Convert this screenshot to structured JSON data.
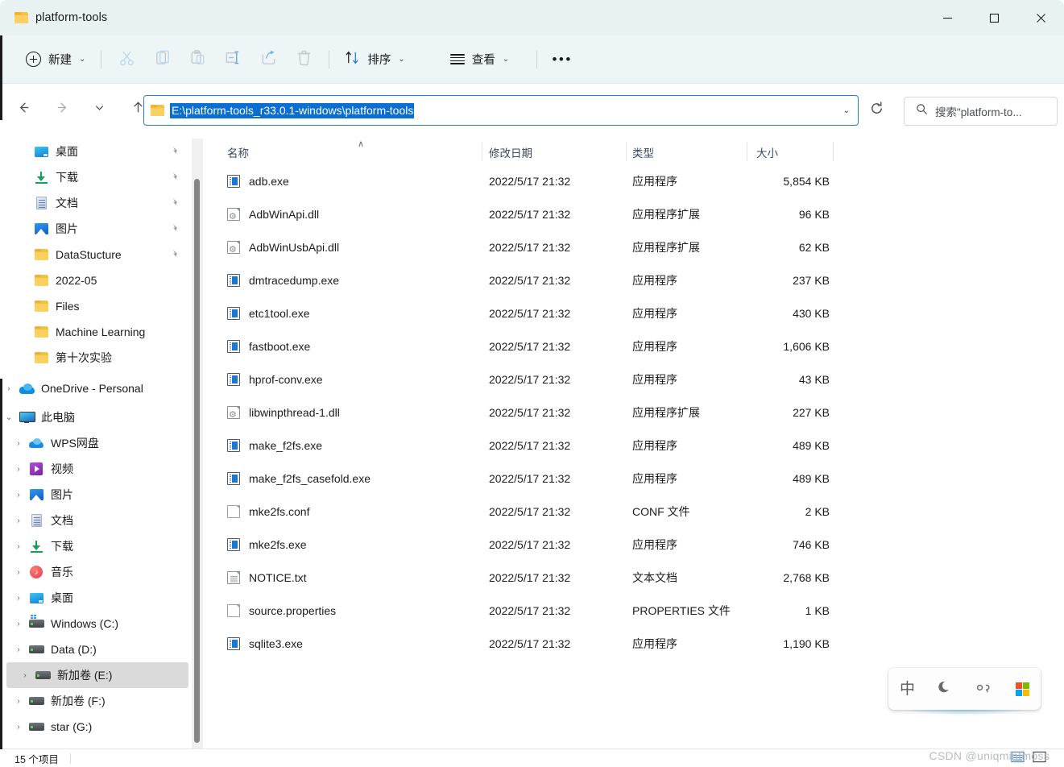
{
  "window": {
    "title": "platform-tools",
    "folder_icon": "folder-icon",
    "minimize": "—",
    "maximize": "□",
    "close": "✕"
  },
  "toolbar": {
    "new_label": "新建",
    "new_icon": "plus-circle-icon",
    "cut_icon": "cut-icon",
    "copy_icon": "copy-icon",
    "paste_icon": "paste-icon",
    "rename_icon": "rename-icon",
    "share_icon": "share-icon",
    "delete_icon": "trash-icon",
    "sort_label": "排序",
    "sort_icon": "sort-icon",
    "view_label": "查看",
    "view_icon": "view-list-icon",
    "more_label": "•••",
    "chevron": "⌄"
  },
  "nav": {
    "back_icon": "arrow-left-icon",
    "forward_icon": "arrow-right-icon",
    "recent_icon": "chevron-down-icon",
    "up_icon": "arrow-up-icon",
    "address_value": "E:\\platform-tools_r33.0.1-windows\\platform-tools",
    "address_chevron": "⌄",
    "refresh_icon": "refresh-icon",
    "search_icon": "search-icon",
    "search_placeholder": "搜索\"platform-to..."
  },
  "sidebar": {
    "quick_access": [
      {
        "label": "桌面",
        "icon": "desktop-icon",
        "pinned": true,
        "expandable": false
      },
      {
        "label": "下载",
        "icon": "download-icon",
        "pinned": true,
        "expandable": false
      },
      {
        "label": "文档",
        "icon": "documents-icon",
        "pinned": true,
        "expandable": false
      },
      {
        "label": "图片",
        "icon": "pictures-icon",
        "pinned": true,
        "expandable": false
      },
      {
        "label": "DataStucture",
        "icon": "folder-icon",
        "pinned": true,
        "expandable": false
      },
      {
        "label": "2022-05",
        "icon": "folder-icon",
        "pinned": false,
        "expandable": false
      },
      {
        "label": "Files",
        "icon": "folder-icon",
        "pinned": false,
        "expandable": false
      },
      {
        "label": "Machine Learning",
        "icon": "folder-icon",
        "pinned": false,
        "expandable": false
      },
      {
        "label": "第十次实验",
        "icon": "folder-icon",
        "pinned": false,
        "expandable": false
      }
    ],
    "onedrive": {
      "label": "OneDrive - Personal",
      "icon": "onedrive-icon",
      "expander": "›"
    },
    "this_pc": {
      "label": "此电脑",
      "icon": "this-pc-icon",
      "expander": "⌄"
    },
    "pc_children": [
      {
        "label": "WPS网盘",
        "icon": "wps-cloud-icon",
        "expander": "›",
        "selected": false
      },
      {
        "label": "视频",
        "icon": "videos-icon",
        "expander": "›",
        "selected": false
      },
      {
        "label": "图片",
        "icon": "pictures-icon",
        "expander": "›",
        "selected": false
      },
      {
        "label": "文档",
        "icon": "documents-icon",
        "expander": "›",
        "selected": false
      },
      {
        "label": "下载",
        "icon": "download-icon",
        "expander": "›",
        "selected": false
      },
      {
        "label": "音乐",
        "icon": "music-icon",
        "expander": "›",
        "selected": false
      },
      {
        "label": "桌面",
        "icon": "desktop-icon",
        "expander": "›",
        "selected": false
      },
      {
        "label": "Windows (C:)",
        "icon": "windows-drive-icon",
        "expander": "›",
        "selected": false
      },
      {
        "label": "Data (D:)",
        "icon": "drive-icon",
        "expander": "›",
        "selected": false
      },
      {
        "label": "新加卷 (E:)",
        "icon": "drive-icon",
        "expander": "›",
        "selected": true
      },
      {
        "label": "新加卷 (F:)",
        "icon": "drive-icon",
        "expander": "›",
        "selected": false
      },
      {
        "label": "star (G:)",
        "icon": "drive-icon",
        "expander": "›",
        "selected": false
      }
    ]
  },
  "filelist": {
    "columns": {
      "name": "名称",
      "date": "修改日期",
      "type": "类型",
      "size": "大小"
    },
    "sort_caret": "∧",
    "rows": [
      {
        "name": "adb.exe",
        "date": "2022/5/17 21:32",
        "type": "应用程序",
        "size": "5,854 KB",
        "icon": "exe-icon"
      },
      {
        "name": "AdbWinApi.dll",
        "date": "2022/5/17 21:32",
        "type": "应用程序扩展",
        "size": "96 KB",
        "icon": "dll-icon"
      },
      {
        "name": "AdbWinUsbApi.dll",
        "date": "2022/5/17 21:32",
        "type": "应用程序扩展",
        "size": "62 KB",
        "icon": "dll-icon"
      },
      {
        "name": "dmtracedump.exe",
        "date": "2022/5/17 21:32",
        "type": "应用程序",
        "size": "237 KB",
        "icon": "exe-icon"
      },
      {
        "name": "etc1tool.exe",
        "date": "2022/5/17 21:32",
        "type": "应用程序",
        "size": "430 KB",
        "icon": "exe-icon"
      },
      {
        "name": "fastboot.exe",
        "date": "2022/5/17 21:32",
        "type": "应用程序",
        "size": "1,606 KB",
        "icon": "exe-icon"
      },
      {
        "name": "hprof-conv.exe",
        "date": "2022/5/17 21:32",
        "type": "应用程序",
        "size": "43 KB",
        "icon": "exe-icon"
      },
      {
        "name": "libwinpthread-1.dll",
        "date": "2022/5/17 21:32",
        "type": "应用程序扩展",
        "size": "227 KB",
        "icon": "dll-icon"
      },
      {
        "name": "make_f2fs.exe",
        "date": "2022/5/17 21:32",
        "type": "应用程序",
        "size": "489 KB",
        "icon": "exe-icon"
      },
      {
        "name": "make_f2fs_casefold.exe",
        "date": "2022/5/17 21:32",
        "type": "应用程序",
        "size": "489 KB",
        "icon": "exe-icon"
      },
      {
        "name": "mke2fs.conf",
        "date": "2022/5/17 21:32",
        "type": "CONF 文件",
        "size": "2 KB",
        "icon": "conf-file-icon"
      },
      {
        "name": "mke2fs.exe",
        "date": "2022/5/17 21:32",
        "type": "应用程序",
        "size": "746 KB",
        "icon": "exe-icon"
      },
      {
        "name": "NOTICE.txt",
        "date": "2022/5/17 21:32",
        "type": "文本文档",
        "size": "2,768 KB",
        "icon": "text-file-icon"
      },
      {
        "name": "source.properties",
        "date": "2022/5/17 21:32",
        "type": "PROPERTIES 文件",
        "size": "1 KB",
        "icon": "properties-file-icon"
      },
      {
        "name": "sqlite3.exe",
        "date": "2022/5/17 21:32",
        "type": "应用程序",
        "size": "1,190 KB",
        "icon": "exe-icon"
      }
    ]
  },
  "statusbar": {
    "item_count": "15 个项目"
  },
  "ime": {
    "mode": "中",
    "shape_icon": "moon-icon",
    "punctuation_icon": "comma-icon",
    "logo_icon": "microsoft-logo-icon"
  },
  "watermark": {
    "text": "CSDN @uniqmintmoss"
  },
  "colors": {
    "titlebar_bg": "#e9f2f2",
    "cmdbar_bg": "#eef5f6",
    "accent_blue": "#0a6fd0",
    "addr_border": "#2a7fc9",
    "selection_gray": "#dadada",
    "folder_yellow": "#f5bf43"
  }
}
